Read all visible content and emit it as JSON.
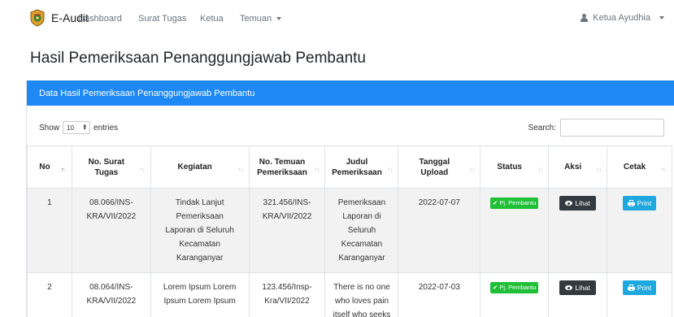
{
  "navbar": {
    "brand": "E-Audit",
    "links": [
      "Dashboard",
      "Surat Tugas",
      "Ketua",
      "Temuan"
    ],
    "user": "Ketua Ayudhia"
  },
  "page": {
    "title": "Hasil Pemeriksaan Penanggungjawab Pembantu"
  },
  "card": {
    "header": "Data Hasil Pemeriksaan Penanggungjawab Pembantu",
    "show_label": "Show",
    "entries_value": "10",
    "entries_label": "entries",
    "search_label": "Search:"
  },
  "table": {
    "headers": {
      "no": "No",
      "surat_line1": "No. Surat",
      "surat_line2": "Tugas",
      "kegiatan": "Kegiatan",
      "temuan_line1": "No. Temuan",
      "temuan_line2": "Pemeriksaan",
      "judul_line1": "Judul",
      "judul_line2": "Pemeriksaan",
      "tanggal_line1": "Tanggal",
      "tanggal_line2": "Upload",
      "status": "Status",
      "aksi": "Aksi",
      "cetak": "Cetak"
    },
    "rows": [
      {
        "no": "1",
        "surat": [
          "08.066/INS-",
          "KRA/VII/2022"
        ],
        "kegiatan": [
          "Tindak Lanjut",
          "Pemeriksaan",
          "Laporan di Seluruh",
          "Kecamatan",
          "Karanganyar"
        ],
        "temuan": [
          "321.456/INS-",
          "KRA/VII/2022"
        ],
        "judul": [
          "Pemeriksaan",
          "Laporan di",
          "Seluruh",
          "Kecamatan",
          "Karanganyar"
        ],
        "tanggal": "2022-07-07",
        "status": "Pj. Pembantu",
        "aksi": "Lihat",
        "cetak": "Print"
      },
      {
        "no": "2",
        "surat": [
          "08.064/INS-",
          "KRA/VII/2022"
        ],
        "kegiatan": [
          "Lorem Ipsum Lorem",
          "Ipsum Lorem Ipsum"
        ],
        "temuan": [
          "123.456/Insp-",
          "Kra/VII/2022"
        ],
        "judul": [
          "There is no one",
          "who loves pain",
          "itself who seeks"
        ],
        "tanggal": "2022-07-03",
        "status": "Pj. Pembantu",
        "aksi": "Lihat",
        "cetak": "Print"
      }
    ]
  },
  "colors": {
    "header_blue": "#1e88f5",
    "badge_green": "#1fbf38",
    "btn_dark": "#333a40",
    "btn_print": "#1fa8dd"
  }
}
